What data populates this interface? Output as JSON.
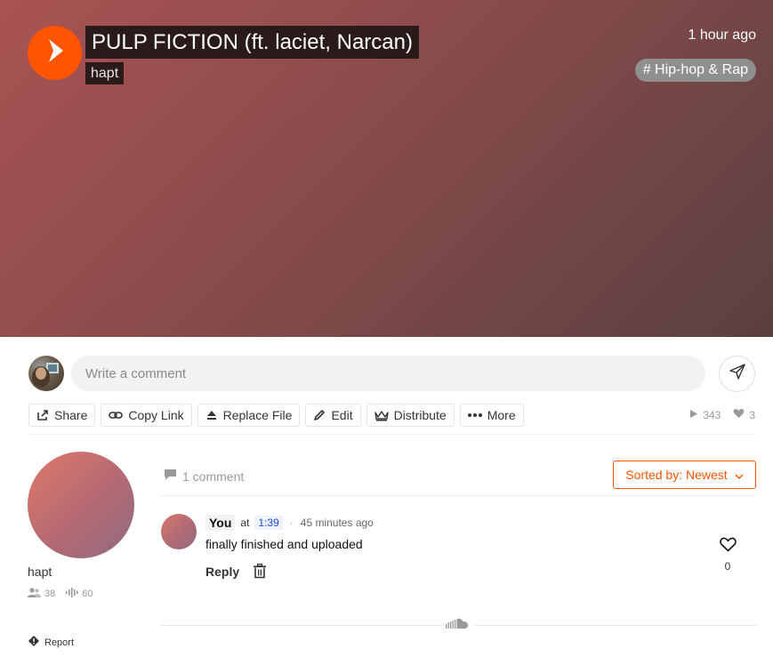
{
  "hero": {
    "title": "PULP FICTION (ft. laciet, Narcan)",
    "artist": "hapt",
    "posted": "1 hour ago",
    "genre": "# Hip-hop & Rap",
    "brand_color": "#ff5500"
  },
  "comment_box": {
    "placeholder": "Write a comment"
  },
  "actions": {
    "share": "Share",
    "copy_link": "Copy Link",
    "replace_file": "Replace File",
    "edit": "Edit",
    "distribute": "Distribute",
    "more": "More"
  },
  "stats": {
    "plays": "343",
    "likes": "3"
  },
  "artist_panel": {
    "name": "hapt",
    "followers": "38",
    "tracks": "60",
    "report": "Report"
  },
  "comments": {
    "count_label": "1 comment",
    "sort_label": "Sorted by: Newest",
    "items": [
      {
        "user": "You",
        "at": "at",
        "timestamp": "1:39",
        "dot": "·",
        "ago": "45 minutes ago",
        "body": "finally finished and uploaded",
        "reply": "Reply",
        "likes": "0"
      }
    ]
  },
  "icons": [
    "play-icon",
    "send-icon",
    "share-icon",
    "link-icon",
    "upload-icon",
    "pencil-icon",
    "crown-icon",
    "ellipsis-icon",
    "play-count-icon",
    "heart-icon",
    "followers-icon",
    "waveform-icon",
    "flag-icon",
    "comment-icon",
    "chevron-down-icon",
    "trash-icon",
    "soundcloud-icon"
  ]
}
